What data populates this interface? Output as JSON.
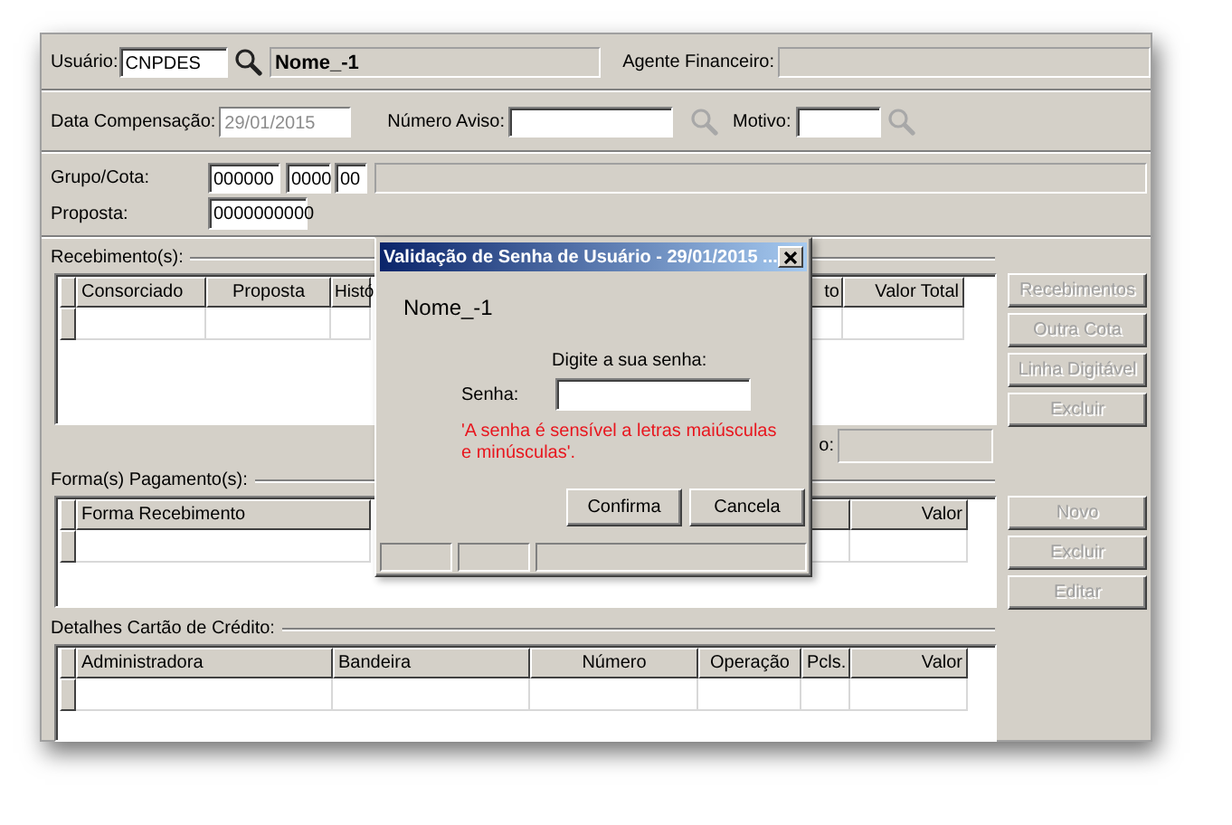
{
  "form": {
    "user": {
      "label": "Usuário:",
      "value": "CNPDES",
      "name": "Nome_-1"
    },
    "agent": {
      "label": "Agente Financeiro:"
    },
    "date": {
      "label": "Data Compensação:",
      "value": "29/01/2015",
      "disabled": true
    },
    "notice": {
      "label": "Número Aviso:",
      "lookup_disabled": true
    },
    "reason": {
      "label": "Motivo:",
      "lookup_disabled": true
    },
    "group": {
      "label": "Grupo/Cota:",
      "group": "000000",
      "quota": "0000",
      "digit": "00"
    },
    "proposal": {
      "label": "Proposta:",
      "value": "0000000000"
    }
  },
  "receipts": {
    "title": "Recebimento(s):",
    "columns": [
      {
        "label": "Consorciado"
      },
      {
        "label": "Proposta"
      },
      {
        "label": "Histó"
      },
      {
        "label": "to"
      },
      {
        "label": "Valor Total"
      }
    ],
    "total_label": "o:",
    "buttons": [
      {
        "label": "Recebimentos",
        "disabled": true
      },
      {
        "label": "Outra Cota",
        "disabled": true
      },
      {
        "label": "Linha Digitável",
        "disabled": true
      },
      {
        "label": "Excluir",
        "disabled": true
      }
    ]
  },
  "payments": {
    "title": "Forma(s) Pagamento(s):",
    "columns": [
      {
        "label": "Forma Recebimento"
      },
      {
        "label": "Valor"
      }
    ],
    "buttons": [
      {
        "label": "Novo",
        "disabled": true
      },
      {
        "label": "Excluir",
        "disabled": true
      },
      {
        "label": "Editar",
        "disabled": true
      }
    ]
  },
  "card": {
    "title": "Detalhes Cartão de Crédito:",
    "columns": [
      {
        "label": "Administradora"
      },
      {
        "label": "Bandeira"
      },
      {
        "label": "Número"
      },
      {
        "label": "Operação"
      },
      {
        "label": "Pcls."
      },
      {
        "label": "Valor"
      }
    ]
  },
  "dialog": {
    "title": "Validação de Senha de Usuário - 29/01/2015 ...",
    "user": "Nome_-1",
    "prompt": "Digite a sua senha:",
    "password_label": "Senha:",
    "warning": "'A senha é sensível a letras maiúsculas e minúsculas'.",
    "buttons": [
      "Confirma",
      "Cancela"
    ]
  }
}
